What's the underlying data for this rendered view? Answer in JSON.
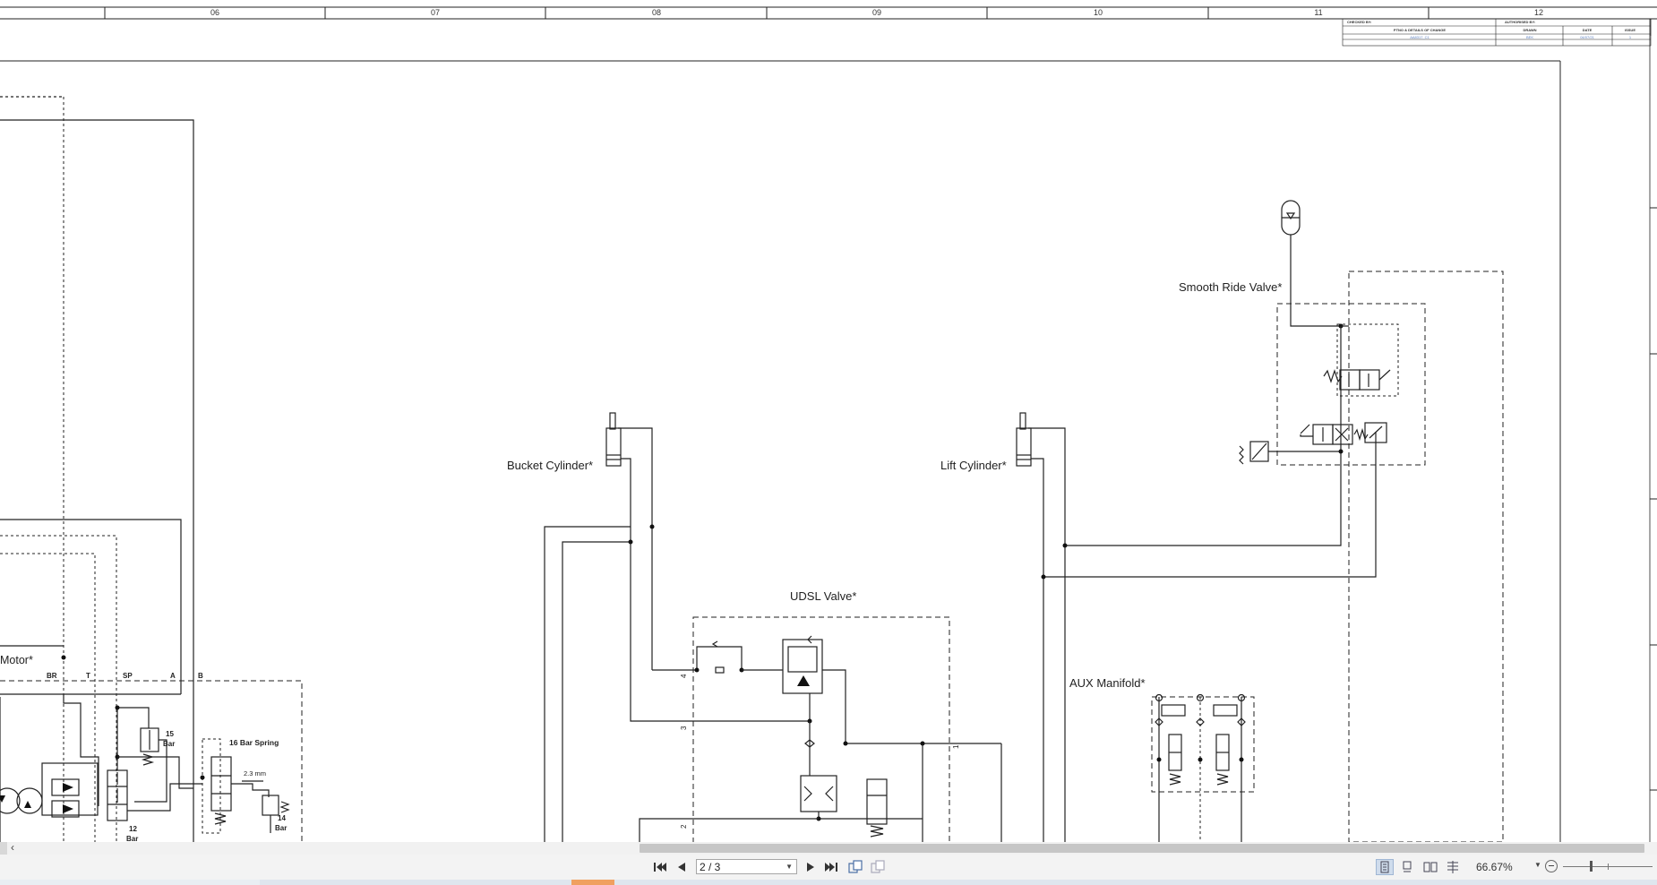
{
  "zone_columns": [
    "06",
    "07",
    "08",
    "09",
    "10",
    "11",
    "12"
  ],
  "title_block": {
    "checked_by": "CHECKED BY:",
    "authorised_by": "AUTHORISED BY:",
    "details_header": "PTNO & DETAILS OF CHANGE",
    "drawn_header": "DRAWN",
    "date_header": "DATE",
    "issue_header": "ISSUE",
    "details_value": "AA8317_C1",
    "drawn_value": "BEK",
    "date_value": "04/07/21",
    "issue_value": "1"
  },
  "components": {
    "bucket_cylinder": "Bucket Cylinder*",
    "lift_cylinder": "Lift Cylinder*",
    "smooth_ride_valve": "Smooth Ride Valve*",
    "udsl_valve": "UDSL Valve*",
    "aux_manifold": "AUX Manifold*",
    "motor": "Motor*",
    "spring_16": "16 Bar Spring",
    "orifice": "2.3 mm",
    "relief_15": "15",
    "relief_15_unit": "Bar",
    "relief_12": "12",
    "relief_12_unit": "Bar",
    "relief_14": "14",
    "relief_14_unit": "Bar"
  },
  "port_labels": {
    "br": "BR",
    "t": "T",
    "sp": "SP",
    "a": "A",
    "b": "B"
  },
  "udsl_ports": {
    "p4": "4",
    "p3": "3",
    "p2": "2",
    "p1": "1"
  },
  "navigation": {
    "page_display": "2 / 3",
    "zoom": "66.67%"
  },
  "icons": {
    "first_page": "first-page-icon",
    "prev_page": "prev-page-icon",
    "next_page": "next-page-icon",
    "last_page": "last-page-icon",
    "prev_view": "previous-view-icon",
    "next_view": "next-view-icon",
    "single_page": "single-page-view-icon",
    "continuous": "continuous-view-icon",
    "facing": "facing-view-icon",
    "continuous_facing": "continuous-facing-view-icon",
    "zoom_out": "zoom-out-icon"
  }
}
